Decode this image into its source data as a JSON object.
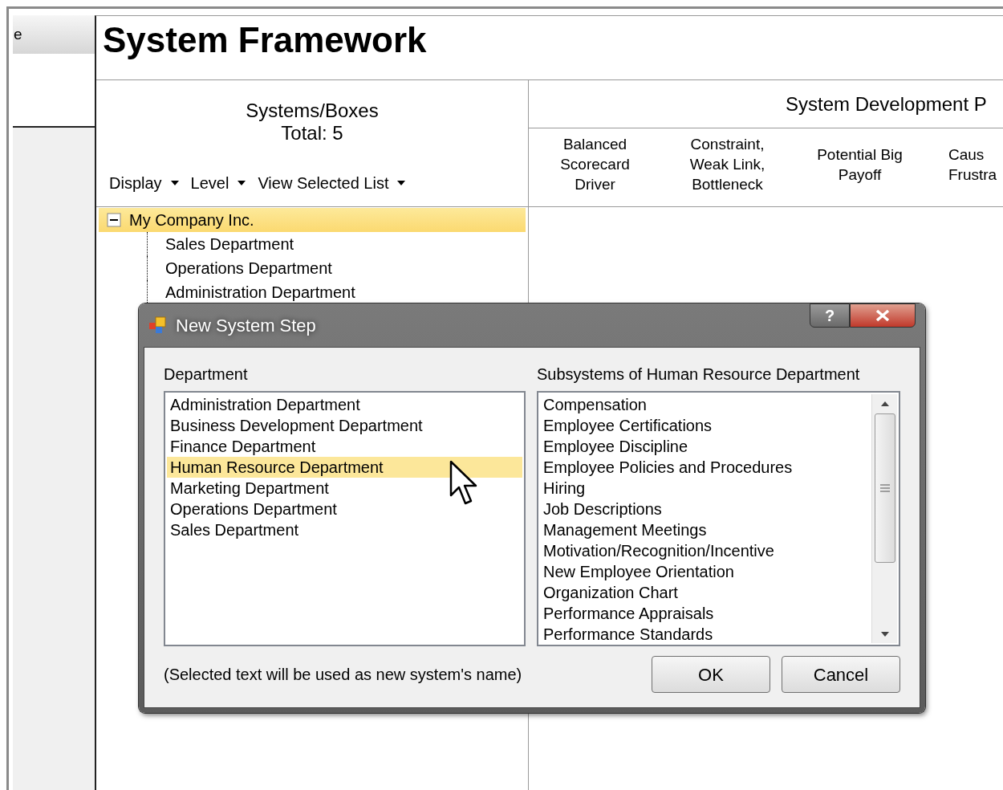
{
  "sidebar": {
    "button_label": "e"
  },
  "title": "System Framework",
  "systems_panel": {
    "heading": "Systems/Boxes",
    "total": "Total: 5",
    "menus": [
      {
        "label": "Display"
      },
      {
        "label": "Level"
      },
      {
        "label": "View Selected List"
      }
    ],
    "tree": [
      {
        "label": "My Company Inc.",
        "expanded": true,
        "selected": true,
        "children": [
          {
            "label": "Sales Department",
            "selected": false
          },
          {
            "label": "Operations Department",
            "selected": false
          },
          {
            "label": "Administration Department",
            "selected": false
          }
        ]
      }
    ]
  },
  "development_panel": {
    "heading": "System Development P",
    "columns": [
      {
        "lines": [
          "Balanced",
          "Scorecard",
          "Driver"
        ]
      },
      {
        "lines": [
          "Constraint,",
          "Weak Link,",
          "Bottleneck"
        ]
      },
      {
        "lines": [
          "Potential Big",
          "Payoff"
        ]
      },
      {
        "lines": [
          "Caus",
          "Frustra"
        ]
      }
    ]
  },
  "dialog": {
    "title": "New System Step",
    "help_button": "?",
    "department_label": "Department",
    "departments": [
      {
        "label": "Administration Department",
        "selected": false
      },
      {
        "label": "Business Development Department",
        "selected": false
      },
      {
        "label": "Finance Department",
        "selected": false
      },
      {
        "label": "Human Resource Department",
        "selected": true
      },
      {
        "label": "Marketing Department",
        "selected": false
      },
      {
        "label": "Operations Department",
        "selected": false
      },
      {
        "label": "Sales Department",
        "selected": false
      }
    ],
    "subsystems_label": "Subsystems of Human Resource Department",
    "subsystems": [
      "Compensation",
      "Employee Certifications",
      "Employee Discipline",
      "Employee Policies and Procedures",
      "Hiring",
      "Job Descriptions",
      "Management Meetings",
      "Motivation/Recognition/Incentive",
      "New Employee Orientation",
      "Organization Chart",
      "Performance Appraisals",
      "Performance Standards"
    ],
    "hint": "(Selected text will be used as new system's name)",
    "buttons": [
      "OK",
      "Cancel"
    ]
  }
}
